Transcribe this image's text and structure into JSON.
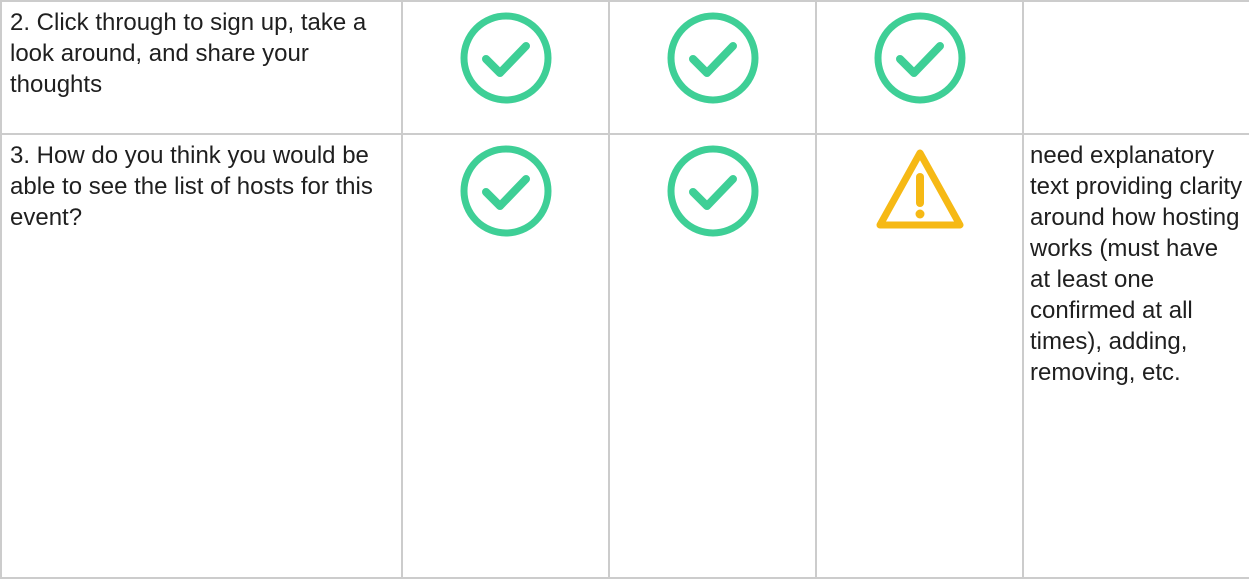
{
  "colors": {
    "check": "#3ecf96",
    "warning": "#f6b915",
    "grid": "#cccccc",
    "text": "#1f1f1f"
  },
  "rows": [
    {
      "question": "2. Click through to sign up, take a look around, and share your thoughts",
      "results": [
        "check-circle-icon",
        "check-circle-icon",
        "check-circle-icon"
      ],
      "notes": ""
    },
    {
      "question": "3. How do you think you would be able to see the list of hosts for this event?",
      "results": [
        "check-circle-icon",
        "check-circle-icon",
        "warning-triangle-icon"
      ],
      "notes": "need explanatory text providing clarity around how hosting works (must have at least one confirmed at all times), adding, removing, etc."
    }
  ]
}
